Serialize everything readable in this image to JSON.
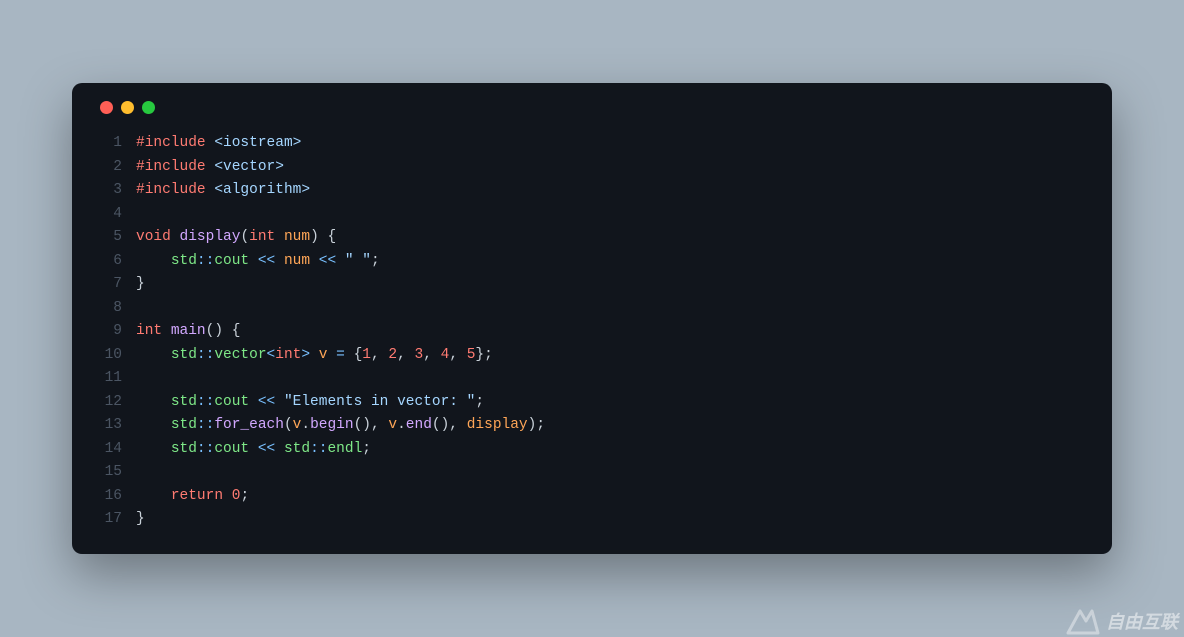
{
  "window": {
    "dots": [
      "close",
      "minimize",
      "zoom"
    ]
  },
  "code": {
    "lines": [
      {
        "n": 1,
        "tokens": [
          [
            "pp",
            "#include "
          ],
          [
            "header",
            "<iostream>"
          ]
        ]
      },
      {
        "n": 2,
        "tokens": [
          [
            "pp",
            "#include "
          ],
          [
            "header",
            "<vector>"
          ]
        ]
      },
      {
        "n": 3,
        "tokens": [
          [
            "pp",
            "#include "
          ],
          [
            "header",
            "<algorithm>"
          ]
        ]
      },
      {
        "n": 4,
        "tokens": [
          [
            "punct",
            ""
          ]
        ]
      },
      {
        "n": 5,
        "tokens": [
          [
            "kw",
            "void "
          ],
          [
            "fn",
            "display"
          ],
          [
            "punct",
            "("
          ],
          [
            "type",
            "int"
          ],
          [
            "punct",
            " "
          ],
          [
            "var",
            "num"
          ],
          [
            "punct",
            ") {"
          ]
        ]
      },
      {
        "n": 6,
        "tokens": [
          [
            "punct",
            "    "
          ],
          [
            "ns",
            "std"
          ],
          [
            "op",
            "::"
          ],
          [
            "ns",
            "cout"
          ],
          [
            "punct",
            " "
          ],
          [
            "op",
            "<<"
          ],
          [
            "punct",
            " "
          ],
          [
            "var",
            "num"
          ],
          [
            "punct",
            " "
          ],
          [
            "op",
            "<<"
          ],
          [
            "punct",
            " "
          ],
          [
            "str",
            "\" \""
          ],
          [
            "punct",
            ";"
          ]
        ]
      },
      {
        "n": 7,
        "tokens": [
          [
            "punct",
            "}"
          ]
        ]
      },
      {
        "n": 8,
        "tokens": [
          [
            "punct",
            ""
          ]
        ]
      },
      {
        "n": 9,
        "tokens": [
          [
            "type",
            "int "
          ],
          [
            "fn",
            "main"
          ],
          [
            "punct",
            "() {"
          ]
        ]
      },
      {
        "n": 10,
        "tokens": [
          [
            "punct",
            "    "
          ],
          [
            "ns",
            "std"
          ],
          [
            "op",
            "::"
          ],
          [
            "ns",
            "vector"
          ],
          [
            "op",
            "<"
          ],
          [
            "type",
            "int"
          ],
          [
            "op",
            ">"
          ],
          [
            "punct",
            " "
          ],
          [
            "var",
            "v"
          ],
          [
            "punct",
            " "
          ],
          [
            "op",
            "="
          ],
          [
            "punct",
            " {"
          ],
          [
            "num",
            "1"
          ],
          [
            "punct",
            ", "
          ],
          [
            "num",
            "2"
          ],
          [
            "punct",
            ", "
          ],
          [
            "num",
            "3"
          ],
          [
            "punct",
            ", "
          ],
          [
            "num",
            "4"
          ],
          [
            "punct",
            ", "
          ],
          [
            "num",
            "5"
          ],
          [
            "punct",
            "};"
          ]
        ]
      },
      {
        "n": 11,
        "tokens": [
          [
            "punct",
            ""
          ]
        ]
      },
      {
        "n": 12,
        "tokens": [
          [
            "punct",
            "    "
          ],
          [
            "ns",
            "std"
          ],
          [
            "op",
            "::"
          ],
          [
            "ns",
            "cout"
          ],
          [
            "punct",
            " "
          ],
          [
            "op",
            "<<"
          ],
          [
            "punct",
            " "
          ],
          [
            "str",
            "\"Elements in vector: \""
          ],
          [
            "punct",
            ";"
          ]
        ]
      },
      {
        "n": 13,
        "tokens": [
          [
            "punct",
            "    "
          ],
          [
            "ns",
            "std"
          ],
          [
            "op",
            "::"
          ],
          [
            "fn",
            "for_each"
          ],
          [
            "punct",
            "("
          ],
          [
            "var",
            "v"
          ],
          [
            "punct",
            "."
          ],
          [
            "fn",
            "begin"
          ],
          [
            "punct",
            "(), "
          ],
          [
            "var",
            "v"
          ],
          [
            "punct",
            "."
          ],
          [
            "fn",
            "end"
          ],
          [
            "punct",
            "(), "
          ],
          [
            "var",
            "display"
          ],
          [
            "punct",
            ");"
          ]
        ]
      },
      {
        "n": 14,
        "tokens": [
          [
            "punct",
            "    "
          ],
          [
            "ns",
            "std"
          ],
          [
            "op",
            "::"
          ],
          [
            "ns",
            "cout"
          ],
          [
            "punct",
            " "
          ],
          [
            "op",
            "<<"
          ],
          [
            "punct",
            " "
          ],
          [
            "ns",
            "std"
          ],
          [
            "op",
            "::"
          ],
          [
            "ns",
            "endl"
          ],
          [
            "punct",
            ";"
          ]
        ]
      },
      {
        "n": 15,
        "tokens": [
          [
            "punct",
            ""
          ]
        ]
      },
      {
        "n": 16,
        "tokens": [
          [
            "punct",
            "    "
          ],
          [
            "kw",
            "return "
          ],
          [
            "num",
            "0"
          ],
          [
            "punct",
            ";"
          ]
        ]
      },
      {
        "n": 17,
        "tokens": [
          [
            "punct",
            "}"
          ]
        ]
      }
    ]
  },
  "watermark": {
    "text": "自由互联"
  }
}
